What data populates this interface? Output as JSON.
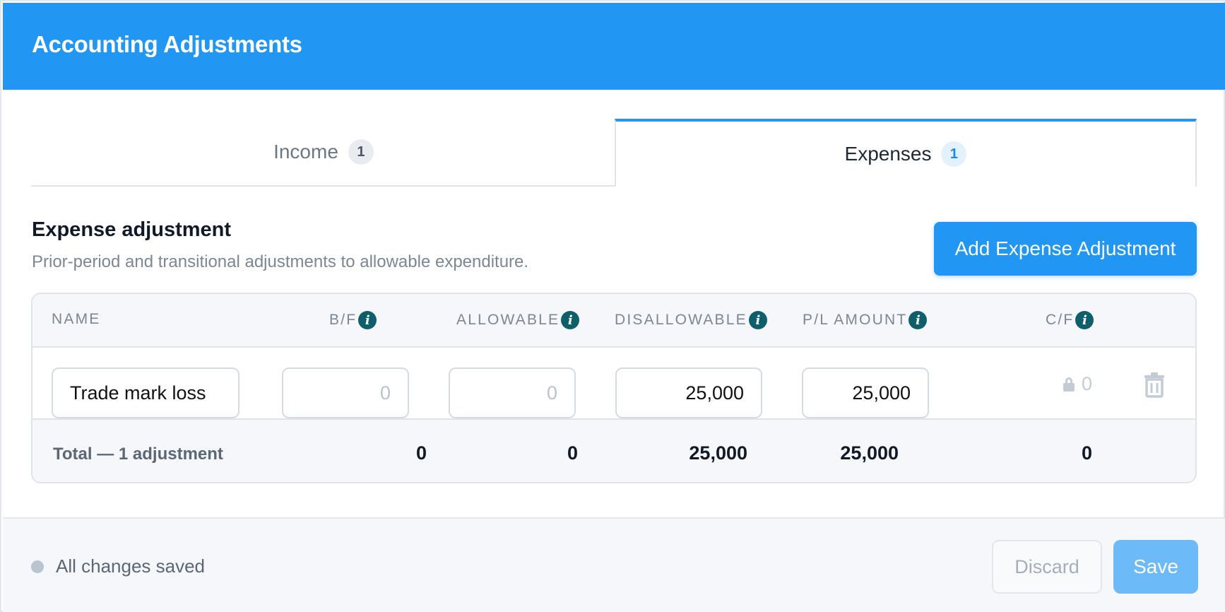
{
  "header": {
    "title": "Accounting Adjustments"
  },
  "tabs": [
    {
      "label": "Income",
      "count": "1",
      "active": false
    },
    {
      "label": "Expenses",
      "count": "1",
      "active": true
    }
  ],
  "section": {
    "title": "Expense adjustment",
    "subtitle": "Prior-period and transitional adjustments to allowable expenditure.",
    "add_button": "Add Expense Adjustment"
  },
  "table": {
    "columns": {
      "name": "NAME",
      "bf": "B/F",
      "allowable": "ALLOWABLE",
      "disallowable": "DISALLOWABLE",
      "pl_amount": "P/L AMOUNT",
      "cf": "C/F"
    },
    "info_icon": "i",
    "rows": [
      {
        "name": "Trade mark loss",
        "bf_value": "",
        "bf_placeholder": "0",
        "allowable_value": "",
        "allowable_placeholder": "0",
        "disallowable": "25,000",
        "pl_amount": "25,000",
        "cf": "0"
      }
    ],
    "totals": {
      "label": "Total — 1 adjustment",
      "bf": "0",
      "allowable": "0",
      "disallowable": "25,000",
      "pl_amount": "25,000",
      "cf": "0"
    }
  },
  "footer": {
    "status": "All changes saved",
    "discard": "Discard",
    "save": "Save"
  },
  "colors": {
    "accent": "#2196f3",
    "info_icon": "#0f5f6b",
    "save_disabled": "#6cbaf8"
  },
  "icons": [
    "info-icon",
    "lock-icon",
    "trash-icon",
    "status-dot-icon"
  ]
}
